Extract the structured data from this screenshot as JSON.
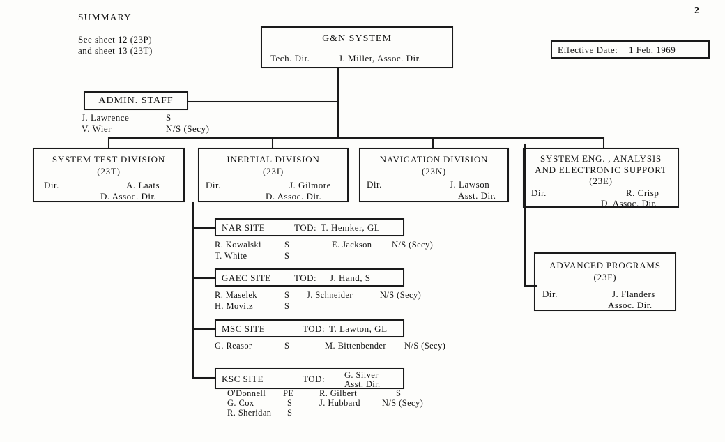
{
  "page": {
    "number": "2",
    "summary_heading": "SUMMARY",
    "summary_line1": "See sheet 12 (23P)",
    "summary_line2": "and sheet 13 (23T)"
  },
  "effective_date": {
    "label": "Effective Date:",
    "value": "1 Feb. 1969"
  },
  "root": {
    "title": "G&N SYSTEM",
    "role_left": "Tech. Dir.",
    "person": "J. Miller, Assoc. Dir."
  },
  "admin_staff": {
    "title": "ADMIN. STAFF",
    "members": [
      {
        "name": "J. Lawrence",
        "code": "S"
      },
      {
        "name": "V. Wier",
        "code": "N/S (Secy)"
      }
    ]
  },
  "divisions": [
    {
      "title": "SYSTEM TEST DIVISION",
      "code": "(23T)",
      "role": "Dir.",
      "person": "A. Laats",
      "person_role": "D. Assoc. Dir."
    },
    {
      "title": "INERTIAL DIVISION",
      "code": "(23I)",
      "role": "Dir.",
      "person": "J. Gilmore",
      "person_role": "D. Assoc. Dir."
    },
    {
      "title": "NAVIGATION DIVISION",
      "code": "(23N)",
      "role": "Dir.",
      "person": "J. Lawson",
      "person_role": "Asst. Dir."
    },
    {
      "title_line1": "SYSTEM ENG. , ANALYSIS",
      "title_line2": "AND ELECTRONIC SUPPORT",
      "code": "(23E)",
      "role": "Dir.",
      "person": "R. Crisp",
      "person_role": "D. Assoc. Dir."
    }
  ],
  "advanced_programs": {
    "title": "ADVANCED PROGRAMS",
    "code": "(23F)",
    "role": "Dir.",
    "person": "J. Flanders",
    "person_role": "Assoc. Dir."
  },
  "sites": [
    {
      "name": "NAR SITE",
      "tod_label": "TOD:",
      "tod_person": "T. Hemker, GL",
      "staff_left": [
        {
          "name": "R. Kowalski",
          "code": "S"
        },
        {
          "name": "T. White",
          "code": "S"
        }
      ],
      "staff_right": [
        {
          "name": "E. Jackson",
          "code": "N/S (Secy)"
        }
      ]
    },
    {
      "name": "GAEC SITE",
      "tod_label": "TOD:",
      "tod_person": "J. Hand, S",
      "staff_left": [
        {
          "name": "R. Maselek",
          "code": "S"
        },
        {
          "name": "H. Movitz",
          "code": "S"
        }
      ],
      "staff_right": [
        {
          "name": "J. Schneider",
          "code": "N/S (Secy)"
        }
      ]
    },
    {
      "name": "MSC SITE",
      "tod_label": "TOD:",
      "tod_person": "T. Lawton, GL",
      "staff_left": [
        {
          "name": "G. Reasor",
          "code": "S"
        }
      ],
      "staff_right": [
        {
          "name": "M. Bittenbender",
          "code": "N/S (Secy)"
        }
      ]
    },
    {
      "name": "KSC SITE",
      "tod_label": "TOD:",
      "tod_person_line1": "G. Silver",
      "tod_person_line2": "Asst. Dir.",
      "staff_left": [
        {
          "name": "O'Donnell",
          "code": "PE"
        },
        {
          "name": "G. Cox",
          "code": "S"
        },
        {
          "name": "R. Sheridan",
          "code": "S"
        }
      ],
      "staff_right": [
        {
          "name": "R. Gilbert",
          "code": "S"
        },
        {
          "name": "J. Hubbard",
          "code": "N/S (Secy)"
        }
      ]
    }
  ]
}
